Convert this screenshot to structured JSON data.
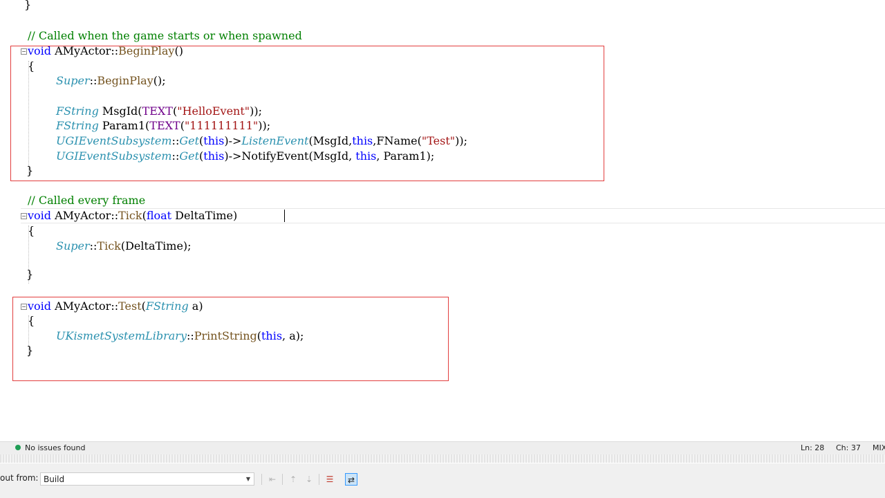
{
  "editor": {
    "lines": [
      {
        "id": "close-brace-top",
        "parts": [
          {
            "t": "}",
            "c": "pl"
          }
        ]
      },
      {
        "id": "comment-beginplay",
        "parts": [
          {
            "t": "// Called when the game starts or when spawned",
            "c": "cm"
          }
        ]
      },
      {
        "id": "beginplay-sig",
        "parts": [
          {
            "t": "void",
            "c": "kw"
          },
          {
            "t": " AMyActor::",
            "c": "pl"
          },
          {
            "t": "BeginPlay",
            "c": "fn"
          },
          {
            "t": "()",
            "c": "pl"
          }
        ]
      },
      {
        "id": "beginplay-open",
        "parts": [
          {
            "t": "{",
            "c": "pl"
          }
        ]
      },
      {
        "id": "super-beginplay",
        "parts": [
          {
            "t": "Super",
            "c": "typ"
          },
          {
            "t": "::",
            "c": "pl"
          },
          {
            "t": "BeginPlay",
            "c": "fn"
          },
          {
            "t": "();",
            "c": "pl"
          }
        ]
      },
      {
        "id": "msgid-decl",
        "parts": [
          {
            "t": "FString",
            "c": "typ"
          },
          {
            "t": " MsgId(",
            "c": "pl"
          },
          {
            "t": "TEXT",
            "c": "mac"
          },
          {
            "t": "(",
            "c": "pl"
          },
          {
            "t": "\"HelloEvent\"",
            "c": "str"
          },
          {
            "t": "));",
            "c": "pl"
          }
        ]
      },
      {
        "id": "param1-decl",
        "parts": [
          {
            "t": "FString",
            "c": "typ"
          },
          {
            "t": " Param1(",
            "c": "pl"
          },
          {
            "t": "TEXT",
            "c": "mac"
          },
          {
            "t": "(",
            "c": "pl"
          },
          {
            "t": "\"111111111\"",
            "c": "str"
          },
          {
            "t": "));",
            "c": "pl"
          }
        ]
      },
      {
        "id": "listen-event",
        "parts": [
          {
            "t": "UGIEventSubsystem",
            "c": "typ"
          },
          {
            "t": "::",
            "c": "pl"
          },
          {
            "t": "Get",
            "c": "typ"
          },
          {
            "t": "(",
            "c": "pl"
          },
          {
            "t": "this",
            "c": "kw"
          },
          {
            "t": ")->",
            "c": "pl"
          },
          {
            "t": "ListenEvent",
            "c": "typ"
          },
          {
            "t": "(MsgId,",
            "c": "pl"
          },
          {
            "t": "this",
            "c": "kw"
          },
          {
            "t": ",FName(",
            "c": "pl"
          },
          {
            "t": "\"Test\"",
            "c": "str"
          },
          {
            "t": "));",
            "c": "pl"
          }
        ]
      },
      {
        "id": "notify-event",
        "parts": [
          {
            "t": "UGIEventSubsystem",
            "c": "typ"
          },
          {
            "t": "::",
            "c": "pl"
          },
          {
            "t": "Get",
            "c": "typ"
          },
          {
            "t": "(",
            "c": "pl"
          },
          {
            "t": "this",
            "c": "kw"
          },
          {
            "t": ")->NotifyEvent(MsgId, ",
            "c": "pl"
          },
          {
            "t": "this",
            "c": "kw"
          },
          {
            "t": ", Param1);",
            "c": "pl"
          }
        ]
      },
      {
        "id": "beginplay-close",
        "parts": [
          {
            "t": "}",
            "c": "pl"
          }
        ]
      },
      {
        "id": "comment-tick",
        "parts": [
          {
            "t": "// Called every frame",
            "c": "cm"
          }
        ]
      },
      {
        "id": "tick-sig",
        "parts": [
          {
            "t": "void",
            "c": "kw"
          },
          {
            "t": " AMyActor::",
            "c": "pl"
          },
          {
            "t": "Tick",
            "c": "fn"
          },
          {
            "t": "(",
            "c": "pl"
          },
          {
            "t": "float",
            "c": "kw"
          },
          {
            "t": " DeltaTime)",
            "c": "pl"
          }
        ]
      },
      {
        "id": "tick-open",
        "parts": [
          {
            "t": "{",
            "c": "pl"
          }
        ]
      },
      {
        "id": "super-tick",
        "parts": [
          {
            "t": "Super",
            "c": "typ"
          },
          {
            "t": "::",
            "c": "pl"
          },
          {
            "t": "Tick",
            "c": "fn"
          },
          {
            "t": "(DeltaTime);",
            "c": "pl"
          }
        ]
      },
      {
        "id": "tick-close",
        "parts": [
          {
            "t": "}",
            "c": "pl"
          }
        ]
      },
      {
        "id": "test-sig",
        "parts": [
          {
            "t": "void",
            "c": "kw"
          },
          {
            "t": " AMyActor::",
            "c": "pl"
          },
          {
            "t": "Test",
            "c": "fn"
          },
          {
            "t": "(",
            "c": "pl"
          },
          {
            "t": "FString",
            "c": "typ"
          },
          {
            "t": " a)",
            "c": "pl"
          }
        ]
      },
      {
        "id": "test-open",
        "parts": [
          {
            "t": "{",
            "c": "pl"
          }
        ]
      },
      {
        "id": "print-string",
        "parts": [
          {
            "t": "UKismetSystemLibrary",
            "c": "typ"
          },
          {
            "t": "::",
            "c": "pl"
          },
          {
            "t": "PrintString",
            "c": "fn"
          },
          {
            "t": "(",
            "c": "pl"
          },
          {
            "t": "this",
            "c": "kw"
          },
          {
            "t": ", a);",
            "c": "pl"
          }
        ]
      },
      {
        "id": "test-close",
        "parts": [
          {
            "t": "}",
            "c": "pl"
          }
        ]
      }
    ]
  },
  "statusbar": {
    "issues": "No issues found",
    "ln": "Ln: 28",
    "ch": "Ch: 37",
    "encoding": "MIX"
  },
  "output": {
    "label": "out from:",
    "source": "Build"
  },
  "colors": {
    "highlight_box": "#e23d3d",
    "ok_icon": "#1f9d55"
  }
}
